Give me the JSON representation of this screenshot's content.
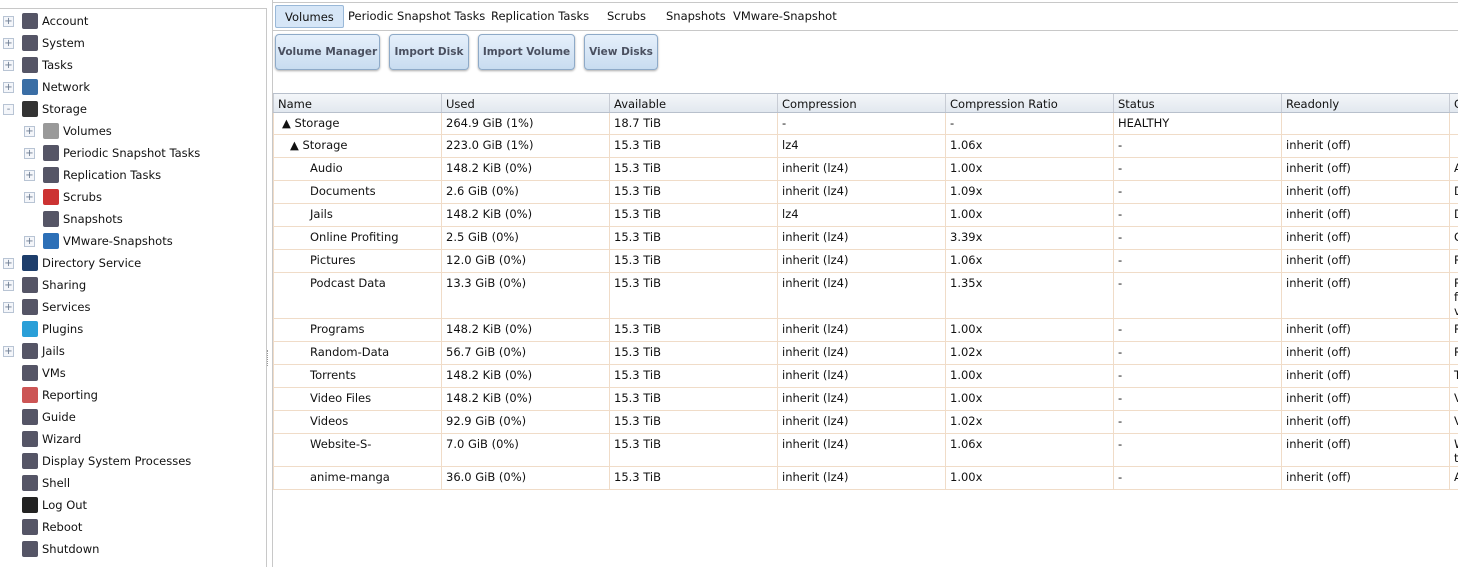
{
  "sidebar": {
    "items": [
      {
        "label": "Account",
        "icon": "users-icon",
        "expander": "+",
        "level": 0
      },
      {
        "label": "System",
        "icon": "system-icon",
        "expander": "+",
        "level": 0
      },
      {
        "label": "Tasks",
        "icon": "tasks-icon",
        "expander": "+",
        "level": 0
      },
      {
        "label": "Network",
        "icon": "network-icon",
        "expander": "+",
        "level": 0
      },
      {
        "label": "Storage",
        "icon": "folder-icon",
        "expander": "-",
        "level": 0
      },
      {
        "label": "Volumes",
        "icon": "database-icon",
        "expander": "+",
        "level": 1
      },
      {
        "label": "Periodic Snapshot Tasks",
        "icon": "clock-snapshot-icon",
        "expander": "+",
        "level": 1
      },
      {
        "label": "Replication Tasks",
        "icon": "replication-icon",
        "expander": "+",
        "level": 1
      },
      {
        "label": "Scrubs",
        "icon": "calendar-icon",
        "expander": "+",
        "level": 1
      },
      {
        "label": "Snapshots",
        "icon": "snapshot-icon",
        "expander": "",
        "level": 1
      },
      {
        "label": "VMware-Snapshots",
        "icon": "vmware-icon",
        "expander": "+",
        "level": 1
      },
      {
        "label": "Directory Service",
        "icon": "directory-icon",
        "expander": "+",
        "level": 0
      },
      {
        "label": "Sharing",
        "icon": "sharing-icon",
        "expander": "+",
        "level": 0
      },
      {
        "label": "Services",
        "icon": "gears-icon",
        "expander": "+",
        "level": 0
      },
      {
        "label": "Plugins",
        "icon": "puzzle-icon",
        "expander": "",
        "level": 0
      },
      {
        "label": "Jails",
        "icon": "jail-icon",
        "expander": "+",
        "level": 0
      },
      {
        "label": "VMs",
        "icon": "monitor-icon",
        "expander": "",
        "level": 0
      },
      {
        "label": "Reporting",
        "icon": "chart-icon",
        "expander": "",
        "level": 0
      },
      {
        "label": "Guide",
        "icon": "book-icon",
        "expander": "",
        "level": 0
      },
      {
        "label": "Wizard",
        "icon": "wizard-hat-icon",
        "expander": "",
        "level": 0
      },
      {
        "label": "Display System Processes",
        "icon": "processes-icon",
        "expander": "",
        "level": 0
      },
      {
        "label": "Shell",
        "icon": "shell-icon",
        "expander": "",
        "level": 0
      },
      {
        "label": "Log Out",
        "icon": "logout-x-icon",
        "expander": "",
        "level": 0
      },
      {
        "label": "Reboot",
        "icon": "reboot-icon",
        "expander": "",
        "level": 0
      },
      {
        "label": "Shutdown",
        "icon": "power-icon",
        "expander": "",
        "level": 0
      }
    ]
  },
  "tabs": [
    "Volumes",
    "Periodic Snapshot Tasks",
    "Replication Tasks",
    "Scrubs",
    "Snapshots",
    "VMware-Snapshot"
  ],
  "toolbar": [
    "Volume Manager",
    "Import Disk",
    "Import Volume",
    "View Disks"
  ],
  "table": {
    "columns": [
      "Name",
      "Used",
      "Available",
      "Compression",
      "Compression Ratio",
      "Status",
      "Readonly",
      "C"
    ],
    "rows": [
      [
        "▲ Storage",
        "264.9 GiB (1%)",
        "18.7 TiB",
        "-",
        "-",
        "HEALTHY",
        "",
        ""
      ],
      [
        "▲ Storage",
        "223.0 GiB (1%)",
        "15.3 TiB",
        "lz4",
        "1.06x",
        "-",
        "inherit (off)",
        ""
      ],
      [
        "Audio",
        "148.2 KiB (0%)",
        "15.3 TiB",
        "inherit (lz4)",
        "1.00x",
        "-",
        "inherit (off)",
        "A"
      ],
      [
        "Documents",
        "2.6 GiB (0%)",
        "15.3 TiB",
        "inherit (lz4)",
        "1.09x",
        "-",
        "inherit (off)",
        "D"
      ],
      [
        "Jails",
        "148.2 KiB (0%)",
        "15.3 TiB",
        "lz4",
        "1.00x",
        "-",
        "inherit (off)",
        "D"
      ],
      [
        "Online Profiting",
        "2.5 GiB (0%)",
        "15.3 TiB",
        "inherit (lz4)",
        "3.39x",
        "-",
        "inherit (off)",
        "O"
      ],
      [
        "Pictures",
        "12.0 GiB (0%)",
        "15.3 TiB",
        "inherit (lz4)",
        "1.06x",
        "-",
        "inherit (off)",
        "P"
      ],
      [
        "Podcast Data",
        "13.3 GiB (0%)",
        "15.3 TiB",
        "inherit (lz4)",
        "1.35x",
        "-",
        "inherit (off)",
        "P\nfi\nv"
      ],
      [
        "Programs",
        "148.2 KiB (0%)",
        "15.3 TiB",
        "inherit (lz4)",
        "1.00x",
        "-",
        "inherit (off)",
        "P"
      ],
      [
        "Random-Data",
        "56.7 GiB (0%)",
        "15.3 TiB",
        "inherit (lz4)",
        "1.02x",
        "-",
        "inherit (off)",
        "R"
      ],
      [
        "Torrents",
        "148.2 KiB (0%)",
        "15.3 TiB",
        "inherit (lz4)",
        "1.00x",
        "-",
        "inherit (off)",
        "T"
      ],
      [
        "Video Files",
        "148.2 KiB (0%)",
        "15.3 TiB",
        "inherit (lz4)",
        "1.00x",
        "-",
        "inherit (off)",
        "V"
      ],
      [
        "Videos",
        "92.9 GiB (0%)",
        "15.3 TiB",
        "inherit (lz4)",
        "1.02x",
        "-",
        "inherit (off)",
        "V"
      ],
      [
        "Website-S-",
        "7.0 GiB (0%)",
        "15.3 TiB",
        "inherit (lz4)",
        "1.06x",
        "-",
        "inherit (off)",
        "W\nth"
      ],
      [
        "anime-manga",
        "36.0 GiB (0%)",
        "15.3 TiB",
        "inherit (lz4)",
        "1.00x",
        "-",
        "inherit (off)",
        "A"
      ]
    ]
  }
}
